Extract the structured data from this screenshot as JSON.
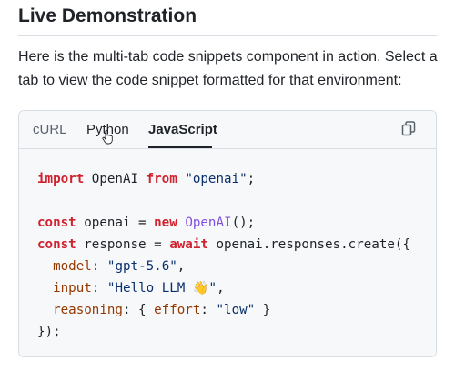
{
  "section": {
    "title": "Live Demonstration",
    "intro": "Here is the multi-tab code snippets component in action. Select a tab to view the code snippet formatted for that environment:"
  },
  "tabs": [
    {
      "label": "cURL",
      "active": false
    },
    {
      "label": "Python",
      "active": false
    },
    {
      "label": "JavaScript",
      "active": true
    }
  ],
  "icons": {
    "copy": "copy-icon",
    "cursor": "hand-pointer-cursor"
  },
  "code": {
    "language": "javascript",
    "line1": {
      "kw1": "import",
      "name": " OpenAI ",
      "kw2": "from",
      "sp": " ",
      "str": "\"openai\"",
      "end": ";"
    },
    "line3": {
      "kw1": "const",
      "name": " openai = ",
      "kw2": "new",
      "sp": " ",
      "cls": "OpenAI",
      "end": "();"
    },
    "line4": {
      "kw1": "const",
      "name": " response = ",
      "kw2": "await",
      "call": " openai.responses.create({"
    },
    "line5": {
      "indent": "  ",
      "prop": "model",
      "sep": ": ",
      "str": "\"gpt-5.6\"",
      "end": ","
    },
    "line6": {
      "indent": "  ",
      "prop": "input",
      "sep": ": ",
      "str": "\"Hello LLM 👋\"",
      "end": ","
    },
    "line7": {
      "indent": "  ",
      "prop": "reasoning",
      "sep": ": { ",
      "prop2": "effort",
      "sep2": ": ",
      "str": "\"low\"",
      "end": " }"
    },
    "line8": {
      "text": "});"
    }
  },
  "colors": {
    "keyword": "#cf222e",
    "string": "#0a3069",
    "class": "#8250df",
    "property": "#953800",
    "code_background": "#f6f8fa",
    "border": "#d8dee4"
  }
}
